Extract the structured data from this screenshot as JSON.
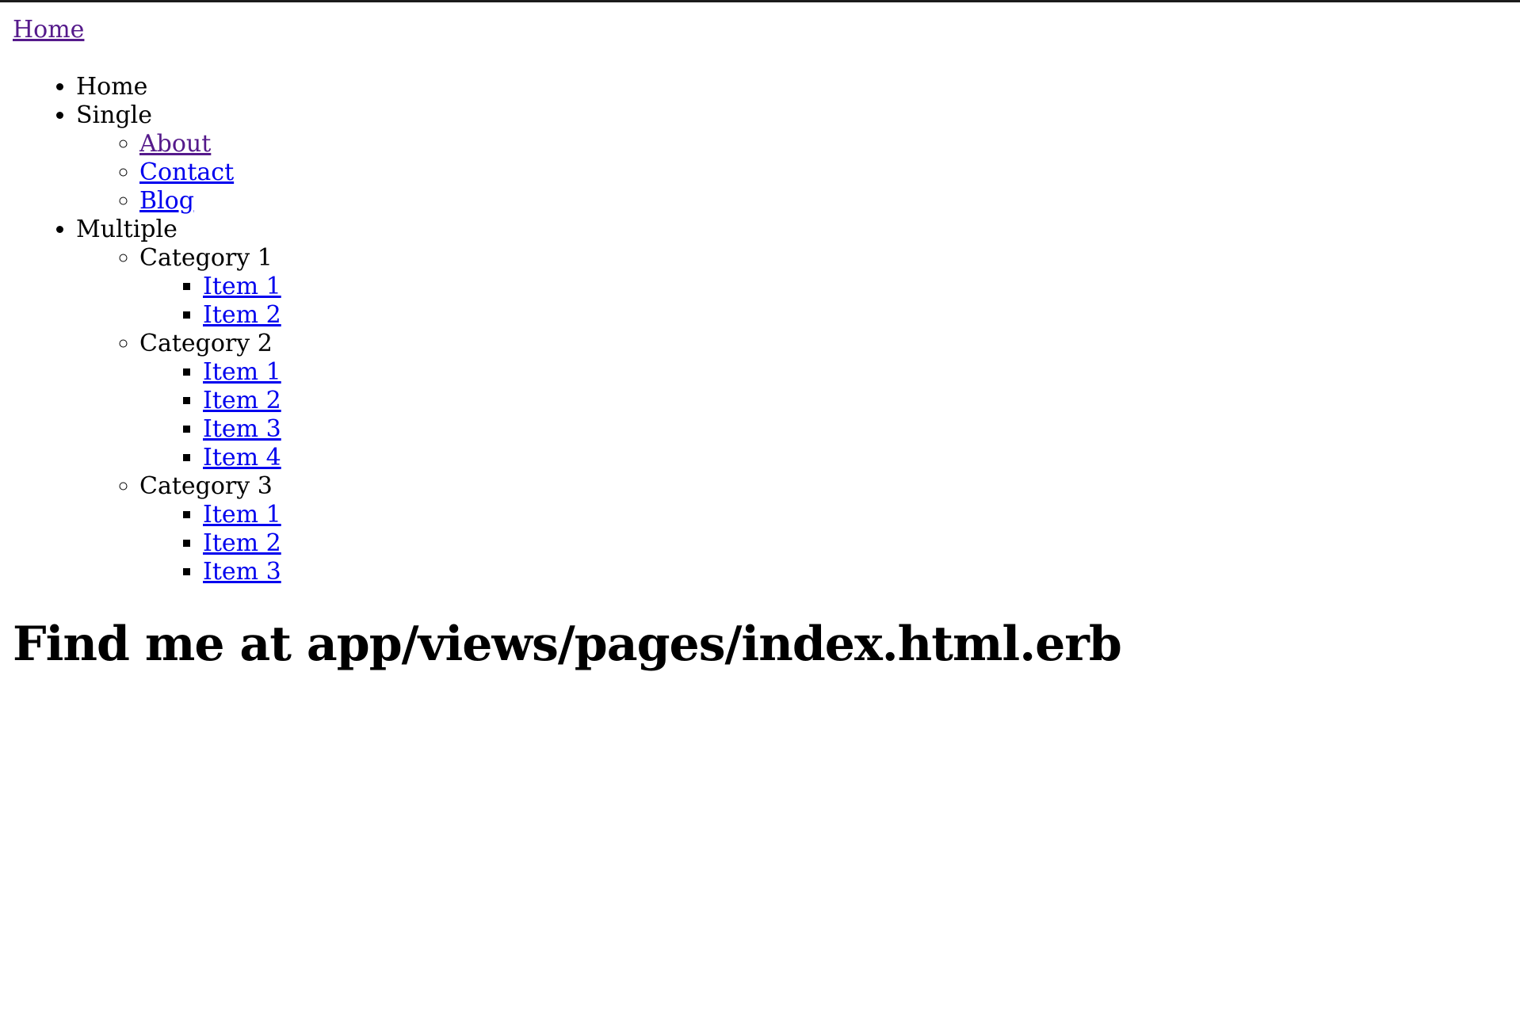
{
  "header": {
    "home_link": "Home"
  },
  "nav": {
    "home": "Home",
    "single": {
      "label": "Single",
      "links": [
        "About",
        "Contact",
        "Blog"
      ]
    },
    "multiple": {
      "label": "Multiple",
      "categories": [
        {
          "label": "Category 1",
          "items": [
            "Item 1",
            "Item 2"
          ]
        },
        {
          "label": "Category 2",
          "items": [
            "Item 1",
            "Item 2",
            "Item 3",
            "Item 4"
          ]
        },
        {
          "label": "Category 3",
          "items": [
            "Item 1",
            "Item 2",
            "Item 3"
          ]
        }
      ]
    }
  },
  "main": {
    "heading": "Find me at app/views/pages/index.html.erb"
  },
  "colors": {
    "link": "#0000ee",
    "visited_link": "#551a8b",
    "text": "#000000",
    "top_border": "#1c1c1c"
  }
}
